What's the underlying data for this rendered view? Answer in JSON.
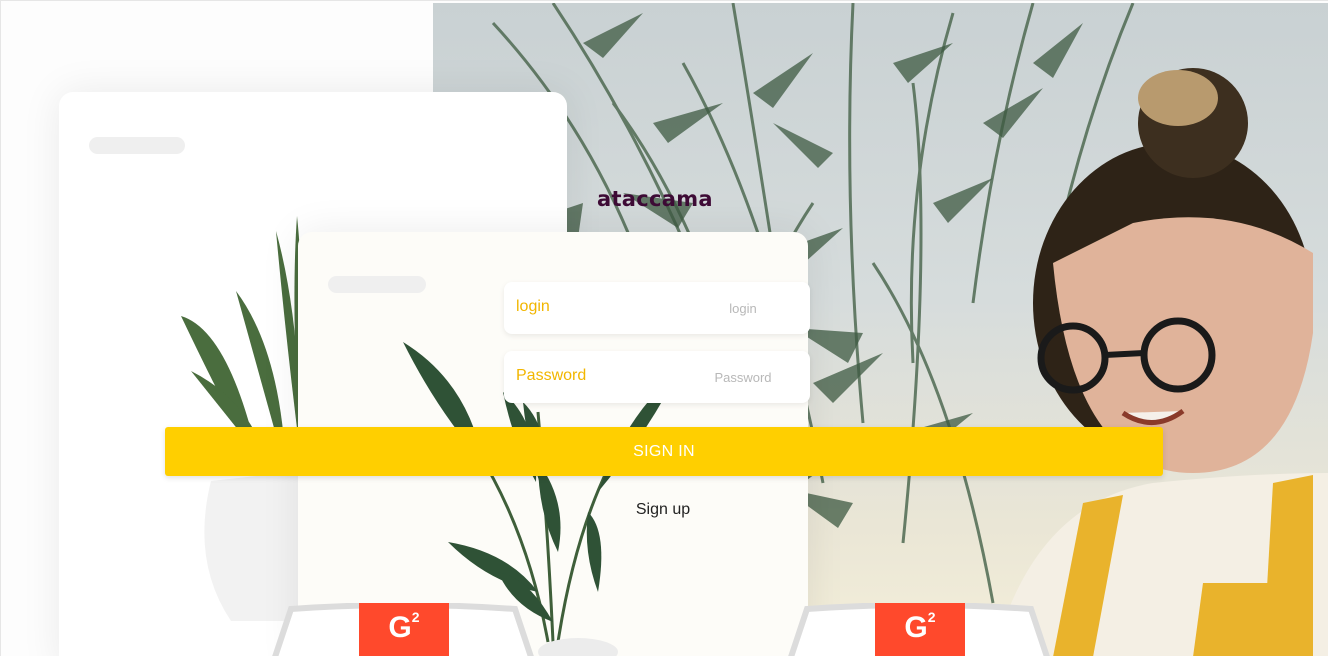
{
  "brand": {
    "name": "ataccama"
  },
  "form": {
    "login_label": "login",
    "login_placeholder": "login",
    "password_label": "Password",
    "password_placeholder": "Password",
    "signin_label": "SIGN IN",
    "signup_label": "Sign up"
  },
  "badges": [
    {
      "text": "G",
      "sup": "2"
    },
    {
      "text": "G",
      "sup": "2"
    }
  ],
  "colors": {
    "accent": "#ffcf00",
    "label": "#f2b600",
    "brand": "#3d0a35",
    "g2": "#ff492c"
  }
}
